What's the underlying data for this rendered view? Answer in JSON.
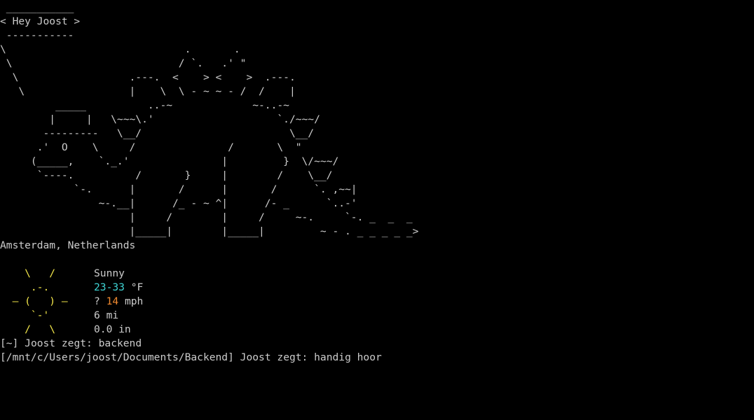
{
  "cowsay": {
    "lines": [
      " ___________",
      "< Hey Joost >",
      " -----------",
      "\\                             .       .",
      " \\                           / `.   .' \"",
      "  \\                  .---.  <    > <    >  .---.",
      "   \\                 |    \\  \\ - ~ ~ - /  /    |",
      "         _____          ..-~             ~-..-~",
      "        |     |   \\~~~\\.'                    `./~~~/",
      "       ---------   \\__/                        \\__/",
      "      .'  O    \\     /               /       \\  \"",
      "     (_____,    `._.'               |         }  \\/~~~/",
      "      `----.          /       }     |        /    \\__/",
      "            `-.      |       /      |       /      `. ,~~|",
      "                ~-.__|      /_ - ~ ^|      /- _      `..-'",
      "                     |     /        |     /     ~-.     `-. _  _  _",
      "                     |_____|        |_____|         ~ - . _ _ _ _ _>"
    ]
  },
  "weather": {
    "location": "Amsterdam, Netherlands",
    "condition": "Sunny",
    "temperature": "23-33",
    "temperature_unit": " °F",
    "wind_arrow": "?",
    "wind_speed": "14",
    "wind_unit": " mph",
    "visibility": "6 mi",
    "precipitation": "0.0 in",
    "icon_lines": [
      "    \\   /    ",
      "     .-.     ",
      "  ― (   ) ―  ",
      "     `-'     ",
      "    /   \\    "
    ]
  },
  "prompts": [
    {
      "path": "[~]",
      "user": "Joost",
      "verb": "zegt:",
      "command": "backend"
    },
    {
      "path": "[/mnt/c/Users/joost/Documents/Backend]",
      "user": "Joost",
      "verb": "zegt:",
      "command": "handig hoor"
    }
  ],
  "colors": {
    "background": "#000000",
    "text": "#cccccc",
    "sun": "#f2e64a",
    "temperature": "#3fd6d6",
    "wind": "#f28a30"
  }
}
